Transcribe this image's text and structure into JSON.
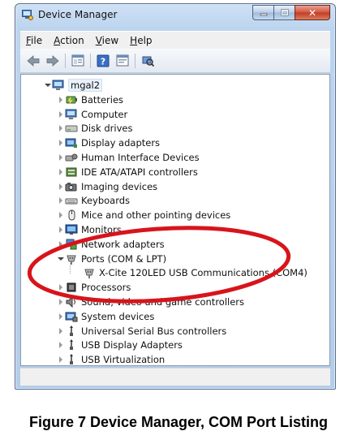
{
  "window": {
    "title": "Device Manager",
    "close_glyph": "✕"
  },
  "menu": [
    "File",
    "Action",
    "View",
    "Help"
  ],
  "menu_access_keys": [
    "F",
    "A",
    "V",
    "H"
  ],
  "toolbar": {
    "icons": [
      "back-icon",
      "forward-icon",
      "properties-icon",
      "help-icon",
      "update-driver-icon",
      "scan-hardware-icon"
    ]
  },
  "tree": {
    "root": {
      "label": "mgal2",
      "icon": "computer-icon"
    },
    "items": [
      {
        "label": "Batteries",
        "icon": "battery-icon"
      },
      {
        "label": "Computer",
        "icon": "computer-icon"
      },
      {
        "label": "Disk drives",
        "icon": "disk-drive-icon"
      },
      {
        "label": "Display adapters",
        "icon": "display-adapter-icon"
      },
      {
        "label": "Human Interface Devices",
        "icon": "hid-icon"
      },
      {
        "label": "IDE ATA/ATAPI controllers",
        "icon": "ide-controller-icon"
      },
      {
        "label": "Imaging devices",
        "icon": "imaging-icon"
      },
      {
        "label": "Keyboards",
        "icon": "keyboard-icon"
      },
      {
        "label": "Mice and other pointing devices",
        "icon": "mouse-icon"
      },
      {
        "label": "Monitors",
        "icon": "monitor-icon"
      },
      {
        "label": "Network adapters",
        "icon": "network-adapter-icon"
      },
      {
        "label": "Ports (COM & LPT)",
        "icon": "port-icon",
        "expanded": true,
        "children": [
          {
            "label": "X-Cite 120LED USB Communications (COM4)",
            "icon": "port-icon"
          }
        ]
      },
      {
        "label": "Processors",
        "icon": "processor-icon"
      },
      {
        "label": "Sound, video and game controllers",
        "icon": "sound-icon"
      },
      {
        "label": "System devices",
        "icon": "system-devices-icon"
      },
      {
        "label": "Universal Serial Bus controllers",
        "icon": "usb-icon"
      },
      {
        "label": "USB Display Adapters",
        "icon": "usb-icon"
      },
      {
        "label": "USB Virtualization",
        "icon": "usb-icon"
      }
    ]
  },
  "annotation": {
    "shape": "ellipse",
    "color": "#d8141b"
  },
  "caption": "Figure 7 Device Manager, COM Port Listing",
  "colors": {
    "title_gradient": "#bcd4ee",
    "close_button": "#c23a1f",
    "annotation": "#d8141b"
  }
}
